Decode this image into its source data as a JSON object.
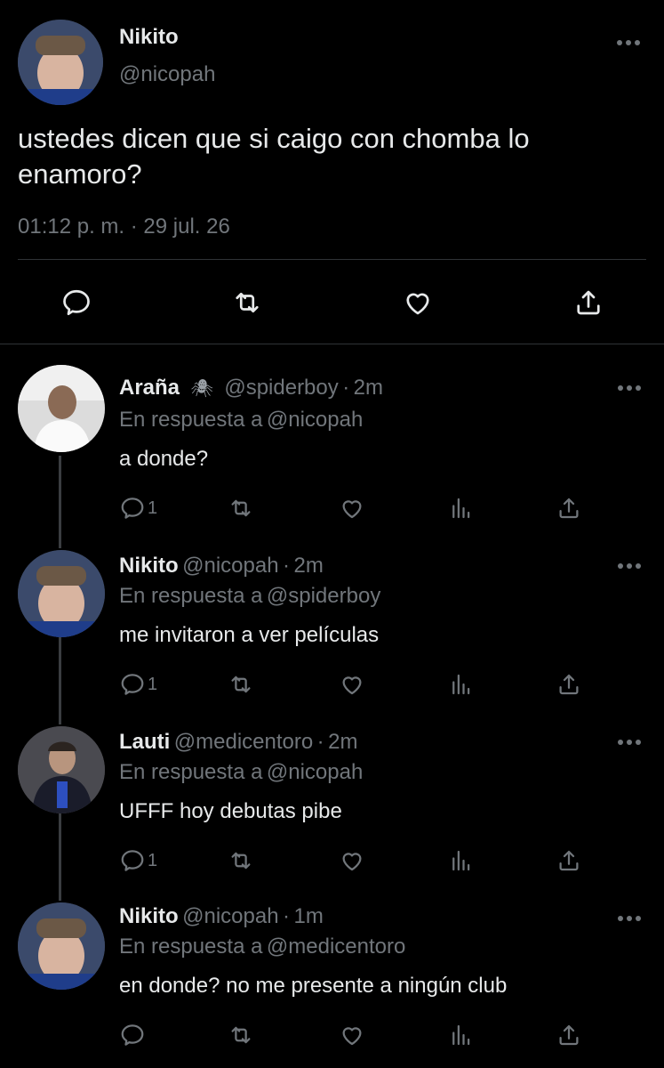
{
  "main_tweet": {
    "name": "Nikito",
    "handle": "@nicopah",
    "text_line1": "ustedes dicen que si caigo con chomba lo",
    "text_line2": "enamoro?",
    "timestamp": "01:12 p. m. · 29 jul. 26"
  },
  "replies": [
    {
      "name": "Araña",
      "name_emoji": "🕷",
      "handle": "@spiderboy",
      "sep": "·",
      "time": "2m",
      "in_reply_prefix": "En respuesta a",
      "in_reply_to": "@nicopah",
      "text": "a donde?",
      "reply_count": "1"
    },
    {
      "name": "Nikito",
      "handle": "@nicopah",
      "sep": "·",
      "time": "2m",
      "in_reply_prefix": "En respuesta a",
      "in_reply_to": "@spiderboy",
      "text": "me invitaron a ver películas",
      "reply_count": "1"
    },
    {
      "name": "Lauti",
      "handle": "@medicentoro",
      "sep": "·",
      "time": "2m",
      "in_reply_prefix": "En respuesta a",
      "in_reply_to": "@nicopah",
      "text": "UFFF hoy debutas pibe",
      "reply_count": "1"
    },
    {
      "name": "Nikito",
      "handle": "@nicopah",
      "sep": "·",
      "time": "1m",
      "in_reply_prefix": "En respuesta a",
      "in_reply_to": "@medicentoro",
      "text": "en donde? no me presente a ningún club",
      "reply_count": ""
    }
  ],
  "colors": {
    "background": "#000000",
    "text": "#e7e9ea",
    "muted": "#71767b",
    "link": "#1d9bf0"
  },
  "icons": [
    "more-icon",
    "reply-icon",
    "retweet-icon",
    "like-icon",
    "share-icon",
    "views-icon"
  ]
}
